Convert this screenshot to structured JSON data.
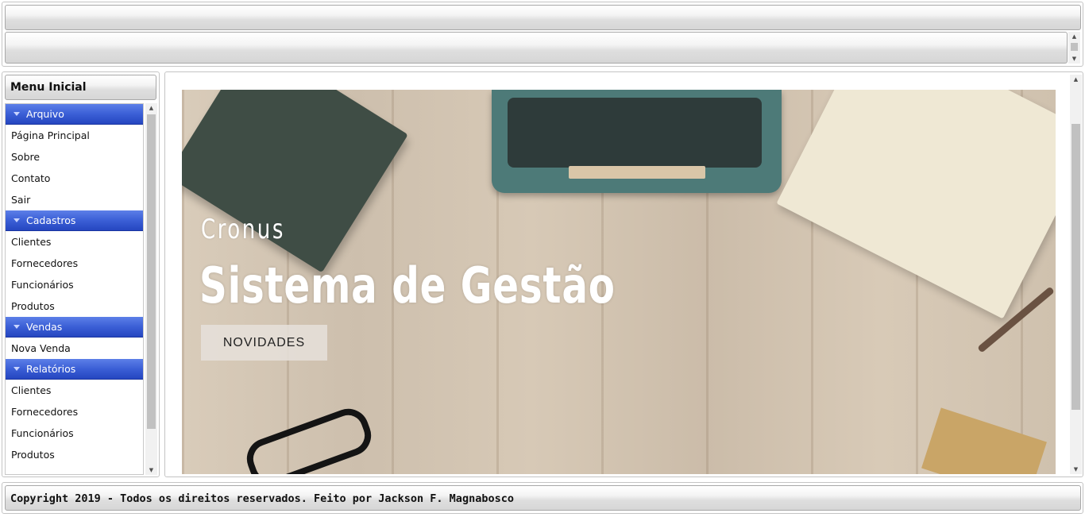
{
  "menu": {
    "title": "Menu Inicial",
    "sections": [
      {
        "label": "Arquivo",
        "items": [
          "Página Principal",
          "Sobre",
          "Contato",
          "Sair"
        ]
      },
      {
        "label": "Cadastros",
        "items": [
          "Clientes",
          "Fornecedores",
          "Funcionários",
          "Produtos"
        ]
      },
      {
        "label": "Vendas",
        "items": [
          "Nova Venda"
        ]
      },
      {
        "label": "Relatórios",
        "items": [
          "Clientes",
          "Fornecedores",
          "Funcionários",
          "Produtos"
        ]
      }
    ]
  },
  "banner": {
    "subtitle": "Cronus",
    "title": "Sistema de Gestão",
    "button_label": "NOVIDADES"
  },
  "footer": {
    "text": "Copyright 2019 - Todos os direitos reservados. Feito por Jackson F. Magnabosco"
  },
  "icons": {
    "section_toggle": "triangle-down-icon",
    "scroll_up": "arrow-up-icon",
    "scroll_down": "arrow-down-icon"
  },
  "colors": {
    "section_header": "#3b5fd6"
  }
}
